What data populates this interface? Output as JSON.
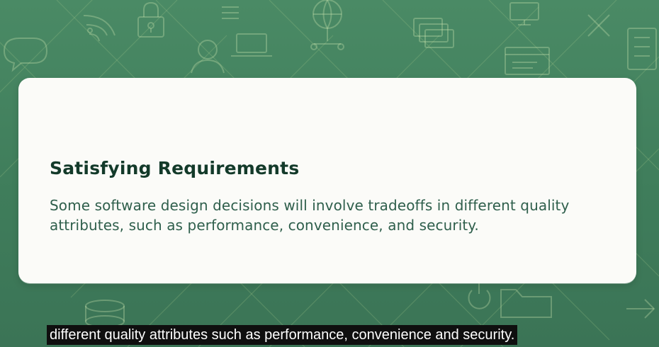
{
  "slide": {
    "title": "Satisfying Requirements",
    "body": "Some software design decisions will involve tradeoffs in different quality attributes, such as performance, convenience, and security."
  },
  "caption": {
    "text": "different quality attributes such as performance, convenience and security."
  },
  "colors": {
    "background": "#3f7d5b",
    "card": "#fbfbf8",
    "title": "#133a2a",
    "body": "#2f5f4c",
    "caption_bg": "#0f0f0f",
    "caption_text": "#ffffff"
  },
  "icons": [
    "chat-bubble-icon",
    "wifi-icon",
    "lock-icon",
    "user-icon",
    "laptop-icon",
    "menu-icon",
    "globe-network-icon",
    "window-stack-icon",
    "monitor-icon",
    "browser-window-icon",
    "close-icon",
    "server-rack-icon",
    "power-icon",
    "database-icon",
    "folder-icon",
    "arrow-icon"
  ]
}
